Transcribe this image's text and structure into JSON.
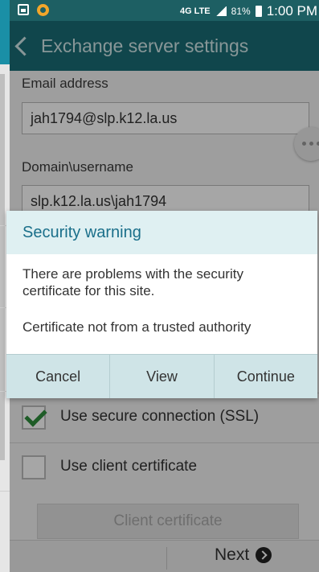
{
  "status_bar": {
    "network": "4G LTE",
    "battery": "81%",
    "time": "1:00 PM"
  },
  "app_bar": {
    "title": "Exchange server settings"
  },
  "form": {
    "email_label": "Email address",
    "email_value": "jah1794@slp.k12.la.us",
    "domain_label": "Domain\\username",
    "domain_value": "slp.k12.la.us\\jah1794",
    "ssl_label": "Use secure connection (SSL)",
    "ssl_checked": true,
    "client_cert_label": "Use client certificate",
    "client_cert_checked": false,
    "client_cert_button": "Client certificate",
    "next_label": "Next"
  },
  "dialog": {
    "title": "Security warning",
    "message": "There are problems with the security certificate for this site.",
    "detail": "Certificate not from a trusted authority",
    "buttons": {
      "cancel": "Cancel",
      "view": "View",
      "continue": "Continue"
    }
  },
  "colors": {
    "status_bar": "#1d5f63",
    "app_bar": "#1a6c75",
    "dialog_title_text": "#1a6f8a",
    "checkmark": "#2f8e3c"
  }
}
